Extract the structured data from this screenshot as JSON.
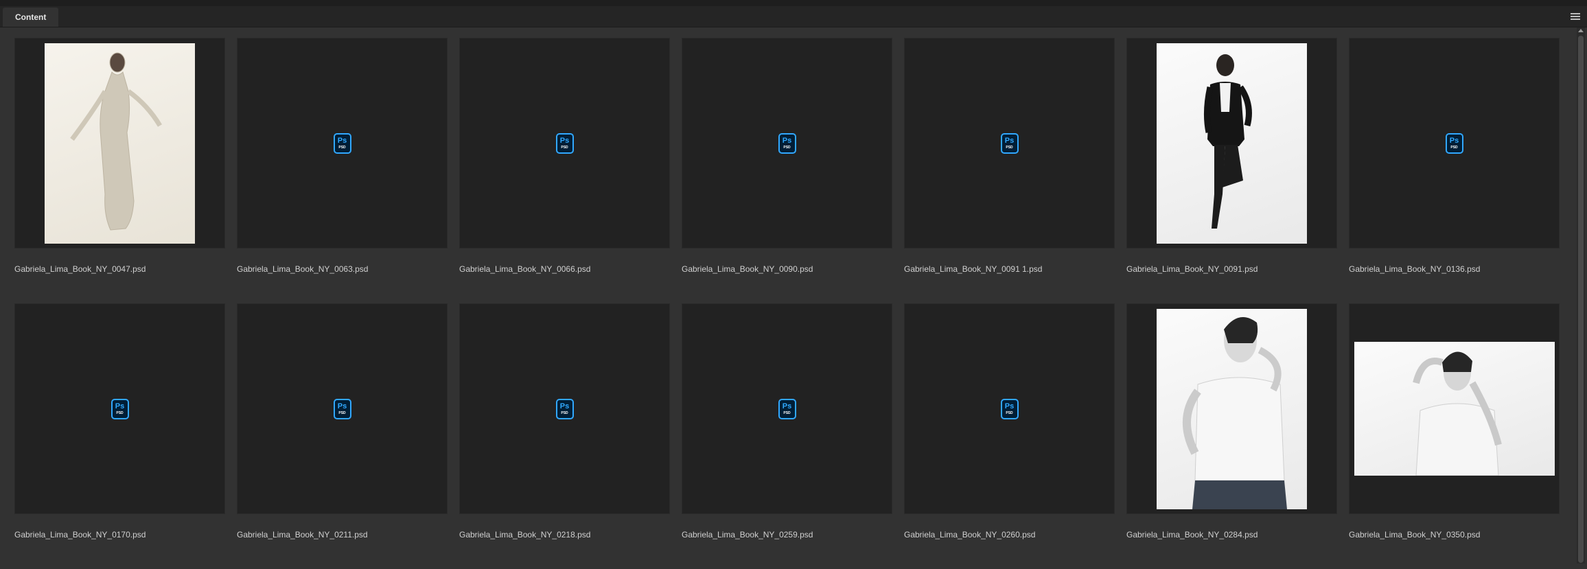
{
  "panel": {
    "tab_label": "Content",
    "menu_icon": "hamburger-menu-icon"
  },
  "thumb_icon": {
    "primary": "Ps",
    "secondary": "PSD",
    "accent": "#31a8ff"
  },
  "items": [
    {
      "file": "Gabriela_Lima_Book_NY_0047.psd",
      "preview": "photo",
      "orientation": "portrait",
      "tone": "cream"
    },
    {
      "file": "Gabriela_Lima_Book_NY_0063.psd",
      "preview": "icon"
    },
    {
      "file": "Gabriela_Lima_Book_NY_0066.psd",
      "preview": "icon"
    },
    {
      "file": "Gabriela_Lima_Book_NY_0090.psd",
      "preview": "icon"
    },
    {
      "file": "Gabriela_Lima_Book_NY_0091 1.psd",
      "preview": "icon"
    },
    {
      "file": "Gabriela_Lima_Book_NY_0091.psd",
      "preview": "photo",
      "orientation": "portrait",
      "tone": "white"
    },
    {
      "file": "Gabriela_Lima_Book_NY_0136.psd",
      "preview": "icon"
    },
    {
      "file": "Gabriela_Lima_Book_NY_0170.psd",
      "preview": "icon"
    },
    {
      "file": "Gabriela_Lima_Book_NY_0211.psd",
      "preview": "icon"
    },
    {
      "file": "Gabriela_Lima_Book_NY_0218.psd",
      "preview": "icon"
    },
    {
      "file": "Gabriela_Lima_Book_NY_0259.psd",
      "preview": "icon"
    },
    {
      "file": "Gabriela_Lima_Book_NY_0260.psd",
      "preview": "icon"
    },
    {
      "file": "Gabriela_Lima_Book_NY_0284.psd",
      "preview": "photo",
      "orientation": "portrait",
      "tone": "white"
    },
    {
      "file": "Gabriela_Lima_Book_NY_0350.psd",
      "preview": "photo",
      "orientation": "landscape",
      "tone": "white"
    }
  ]
}
